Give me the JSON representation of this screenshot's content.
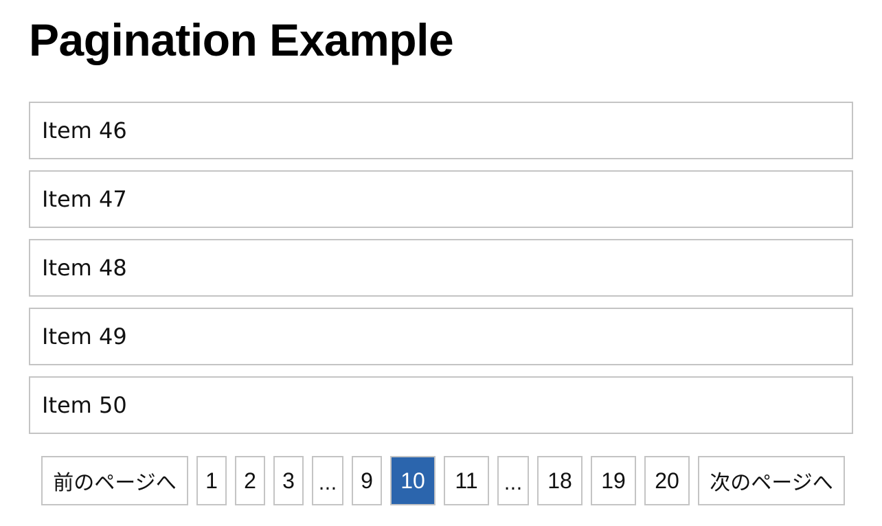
{
  "page": {
    "title": "Pagination Example"
  },
  "items": [
    {
      "label": "Item 46"
    },
    {
      "label": "Item 47"
    },
    {
      "label": "Item 48"
    },
    {
      "label": "Item 49"
    },
    {
      "label": "Item 50"
    }
  ],
  "pagination": {
    "prev_label": "前のページへ",
    "next_label": "次のページへ",
    "current_page": "10",
    "buttons": [
      {
        "label": "1"
      },
      {
        "label": "2"
      },
      {
        "label": "3"
      },
      {
        "label": "..."
      },
      {
        "label": "9"
      },
      {
        "label": "10"
      },
      {
        "label": "11"
      },
      {
        "label": "..."
      },
      {
        "label": "18"
      },
      {
        "label": "19"
      },
      {
        "label": "20"
      }
    ]
  },
  "colors": {
    "active_background": "#2b65ad",
    "active_text": "#ffffff",
    "border": "#c4c4c4"
  }
}
